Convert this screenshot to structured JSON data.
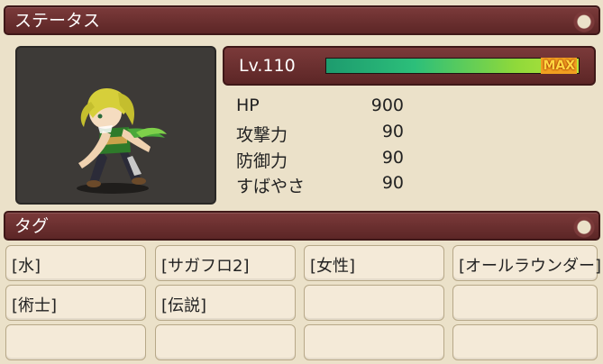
{
  "status_section": {
    "title": "ステータス"
  },
  "level": {
    "label": "Lv.110",
    "max_label": "MAX",
    "fill": 1.0
  },
  "stats": [
    {
      "name": "HP",
      "value": "900"
    },
    {
      "name": "攻撃力",
      "value": "90"
    },
    {
      "name": "防御力",
      "value": "90"
    },
    {
      "name": "すばやさ",
      "value": "90"
    }
  ],
  "tags_section": {
    "title": "タグ"
  },
  "tags": [
    "[水]",
    "[サガフロ2]",
    "[女性]",
    "[オールラウンダー]",
    "[術士]",
    "[伝説]",
    "",
    "",
    "",
    "",
    "",
    ""
  ],
  "colors": {
    "bar": "#7b3a3a",
    "panel": "#ebe1c9",
    "gauge_start": "#1d9b6e",
    "gauge_end": "#b8e43a",
    "max": "#ffd640"
  }
}
